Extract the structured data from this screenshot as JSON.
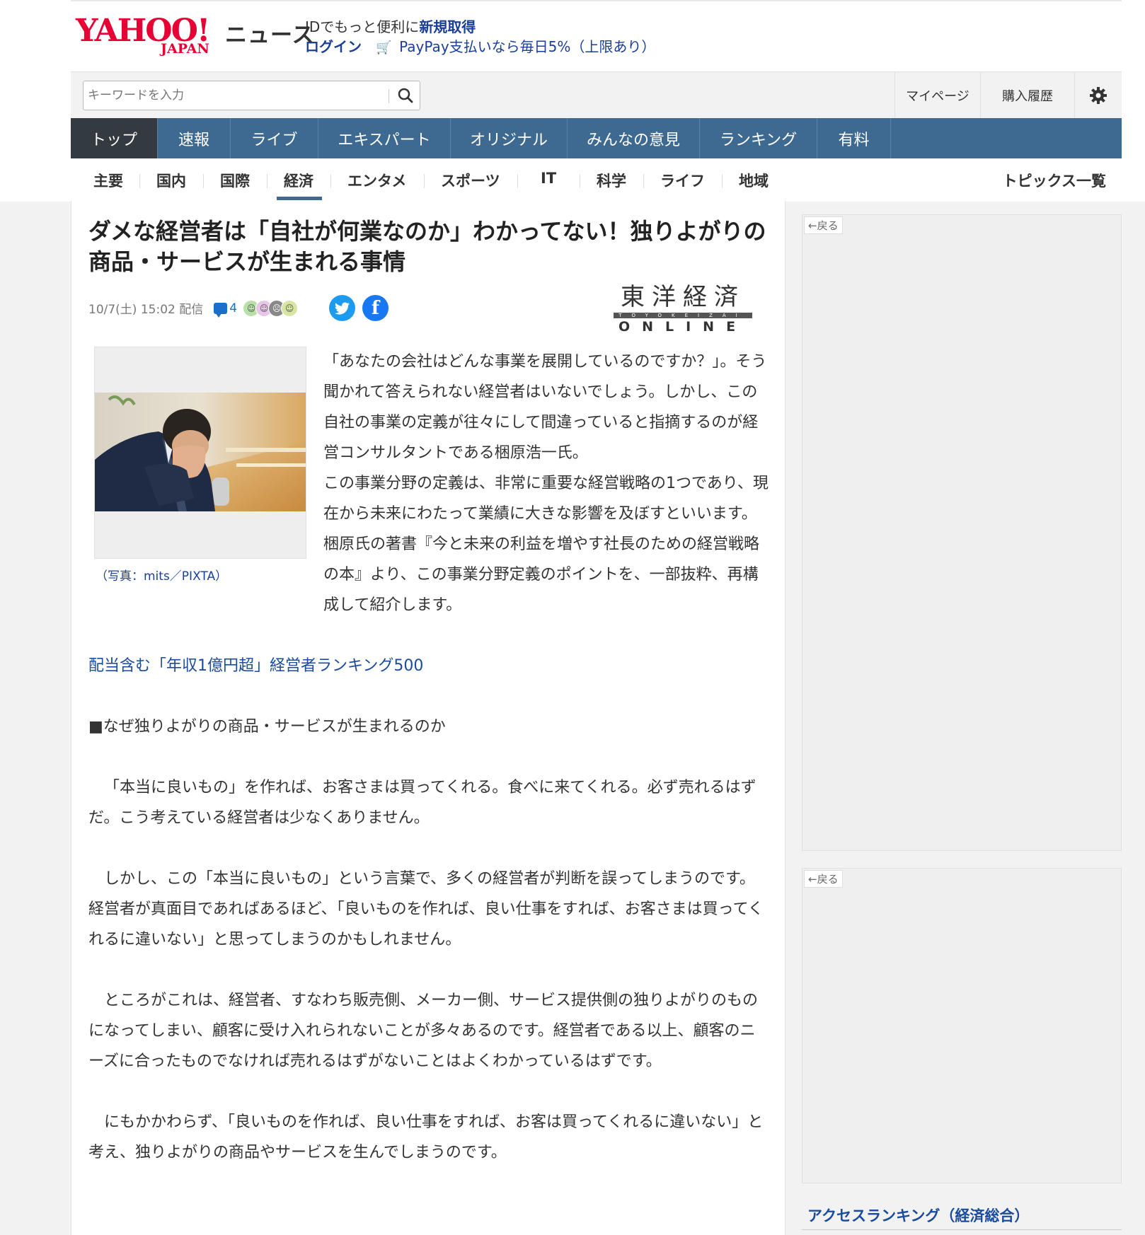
{
  "header": {
    "logo_text": "YAHOO!",
    "logo_sub": "JAPAN",
    "section_name": "ニュース",
    "id_promo_prefix": "IDでもっと便利に",
    "id_signup": "新規取得",
    "login": "ログイン",
    "paypay_promo": "PayPay支払いなら毎日5%（上限あり）"
  },
  "search": {
    "placeholder": "キーワードを入力",
    "my_page": "マイページ",
    "purchase_history": "購入履歴"
  },
  "main_nav": [
    "トップ",
    "速報",
    "ライブ",
    "エキスパート",
    "オリジナル",
    "みんなの意見",
    "ランキング",
    "有料"
  ],
  "sub_nav": [
    "主要",
    "国内",
    "国際",
    "経済",
    "エンタメ",
    "スポーツ",
    "IT",
    "科学",
    "ライフ",
    "地域"
  ],
  "sub_nav_active": "経済",
  "topics_link": "トピックス一覧",
  "article": {
    "title": "ダメな経営者は「自社が何業なのか」わかってない！独りよがりの商品・サービスが生まれる事情",
    "date": "10/7(土) 15:02 配信",
    "comment_count": "4",
    "publisher_jp": "東洋経済",
    "publisher_roman": "TOYOKEIZAI",
    "publisher_online": "ONLINE",
    "photo_caption": "（写真：mits／PIXTA）",
    "lead": "「あなたの会社はどんな事業を展開しているのですか？」。そう聞かれて答えられない経営者はいないでしょう。しかし、この自社の事業の定義が往々にして間違っていると指摘するのが経営コンサルタントである梱原浩一氏。",
    "lead2": "この事業分野の定義は、非常に重要な経営戦略の1つであり、現在から未来にわたって業績に大きな影響を及ぼすといいます。梱原氏の著書『今と未来の利益を増やす社長のための経営戦略の本』より、この事業分野定義のポイントを、一部抜粋、再構成して紹介します。",
    "related_link": "配当含む「年収1億円超」経営者ランキング500",
    "heading": "■なぜ独りよがりの商品・サービスが生まれるのか",
    "para1": "「本当に良いもの」を作れば、お客さまは買ってくれる。食べに来てくれる。必ず売れるはずだ。こう考えている経営者は少なくありません。",
    "para2": "しかし、この「本当に良いもの」という言葉で、多くの経営者が判断を誤ってしまうのです。経営者が真面目であればあるほど、「良いものを作れば、良い仕事をすれば、お客さまは買ってくれるに違いない」と思ってしまうのかもしれません。",
    "para3": "ところがこれは、経営者、すなわち販売側、メーカー側、サービス提供側の独りよがりのものになってしまい、顧客に受け入れられないことが多々あるのです。経営者である以上、顧客のニーズに合ったものでなければ売れるはずがないことはよくわかっているはずです。",
    "para4": "にもかかわらず、「良いものを作れば、良い仕事をすれば、お客は買ってくれるに違いない」と考え、独りよがりの商品やサービスを生んでしまうのです。"
  },
  "sidebar": {
    "back_label": "←戻る",
    "ranking_title": "アクセスランキング（経済総合）"
  },
  "colors": {
    "brand_red": "#e60033",
    "nav_blue": "#3e6a92",
    "link_blue": "#1a4b9c"
  }
}
